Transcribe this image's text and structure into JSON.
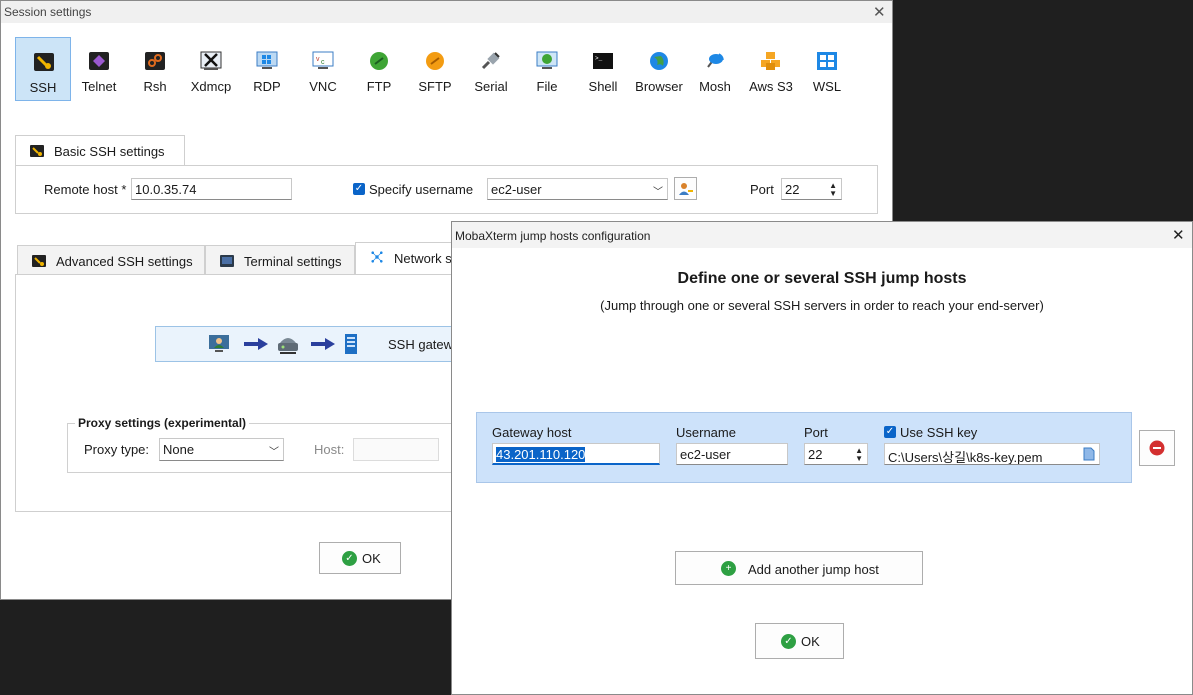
{
  "session": {
    "title": "Session settings",
    "close": "✕",
    "protocols": [
      {
        "label": "SSH",
        "icon": "ssh-icon"
      },
      {
        "label": "Telnet",
        "icon": "telnet-icon"
      },
      {
        "label": "Rsh",
        "icon": "rsh-icon"
      },
      {
        "label": "Xdmcp",
        "icon": "xdmcp-icon"
      },
      {
        "label": "RDP",
        "icon": "rdp-icon"
      },
      {
        "label": "VNC",
        "icon": "vnc-icon"
      },
      {
        "label": "FTP",
        "icon": "ftp-icon"
      },
      {
        "label": "SFTP",
        "icon": "sftp-icon"
      },
      {
        "label": "Serial",
        "icon": "serial-icon"
      },
      {
        "label": "File",
        "icon": "file-icon"
      },
      {
        "label": "Shell",
        "icon": "shell-icon"
      },
      {
        "label": "Browser",
        "icon": "browser-icon"
      },
      {
        "label": "Mosh",
        "icon": "mosh-icon"
      },
      {
        "label": "Aws S3",
        "icon": "aws-s3-icon"
      },
      {
        "label": "WSL",
        "icon": "wsl-icon"
      }
    ],
    "basic_tab": "Basic SSH settings",
    "remote_host_label": "Remote host *",
    "remote_host_value": "10.0.35.74",
    "specify_username_label": "Specify username",
    "username_value": "ec2-user",
    "port_label": "Port",
    "port_value": "22",
    "tabs": {
      "advanced": "Advanced SSH settings",
      "terminal": "Terminal settings",
      "network": "Network s"
    },
    "gateway_label": "SSH gatew",
    "proxy_group_label": "Proxy settings (experimental)",
    "proxy_type_label": "Proxy type:",
    "proxy_type_value": "None",
    "proxy_host_label": "Host:",
    "ok_label": "OK"
  },
  "jump": {
    "title": "MobaXterm jump hosts configuration",
    "close": "✕",
    "heading": "Define one or several SSH jump hosts",
    "subheading": "(Jump through one or several SSH servers in order to reach your end-server)",
    "columns": {
      "gateway": "Gateway host",
      "username": "Username",
      "port": "Port",
      "use_key": "Use SSH key"
    },
    "row": {
      "gateway": "43.201.110.120",
      "username": "ec2-user",
      "port": "22",
      "key_path": "C:\\Users\\상길\\k8s-key.pem"
    },
    "add_label": "Add another jump host",
    "ok_label": "OK"
  },
  "colors": {
    "accent": "#0a64c8",
    "selection_bg": "#cce4f7",
    "row_bg": "#cde2fa",
    "ok_green": "#2ea043",
    "remove_red": "#d32f2f"
  }
}
